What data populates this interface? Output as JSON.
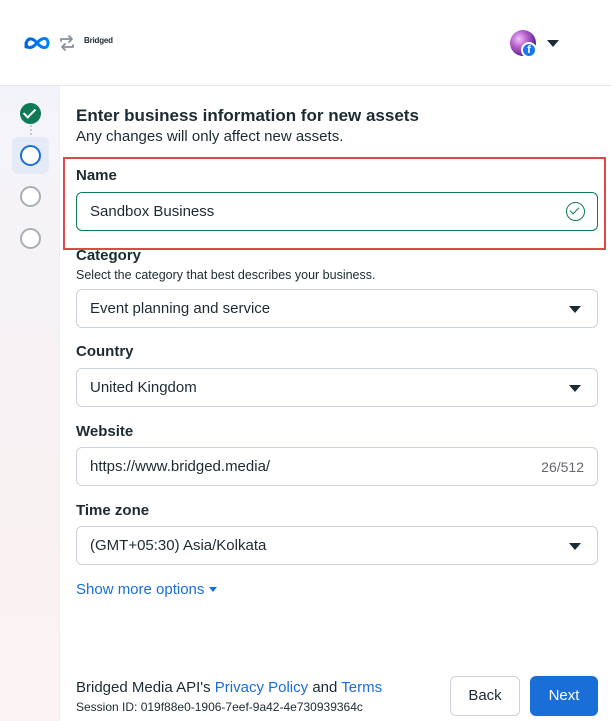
{
  "header": {
    "brand_logo_text": "Bridged",
    "meta_logo_icon": "meta-infinity-icon",
    "sync_icon": "sync-arrows-icon",
    "avatar_badge": "f"
  },
  "stepper": {
    "steps": [
      {
        "state": "complete"
      },
      {
        "state": "current"
      },
      {
        "state": "pending"
      },
      {
        "state": "pending"
      }
    ]
  },
  "form": {
    "title": "Enter business information for new assets",
    "subtitle": "Any changes will only affect new assets.",
    "name": {
      "label": "Name",
      "value": "Sandbox Business",
      "status": "valid"
    },
    "category": {
      "label": "Category",
      "helper": "Select the category that best describes your business.",
      "value": "Event planning and service"
    },
    "country": {
      "label": "Country",
      "value": "United Kingdom"
    },
    "website": {
      "label": "Website",
      "value": "https://www.bridged.media/",
      "count": "26/512"
    },
    "timezone": {
      "label": "Time zone",
      "value": "(GMT+05:30) Asia/Kolkata"
    },
    "show_more": "Show more options"
  },
  "footer": {
    "prefix": "Bridged Media API's",
    "privacy_link": "Privacy Policy",
    "and": "and",
    "terms_link": "Terms",
    "session": "Session ID: 019f88e0-1906-7eef-9a42-4e730939364c",
    "back_label": "Back",
    "next_label": "Next"
  },
  "colors": {
    "accent": "#1a6ed8",
    "success": "#0f7a55",
    "highlight": "#e04848"
  }
}
